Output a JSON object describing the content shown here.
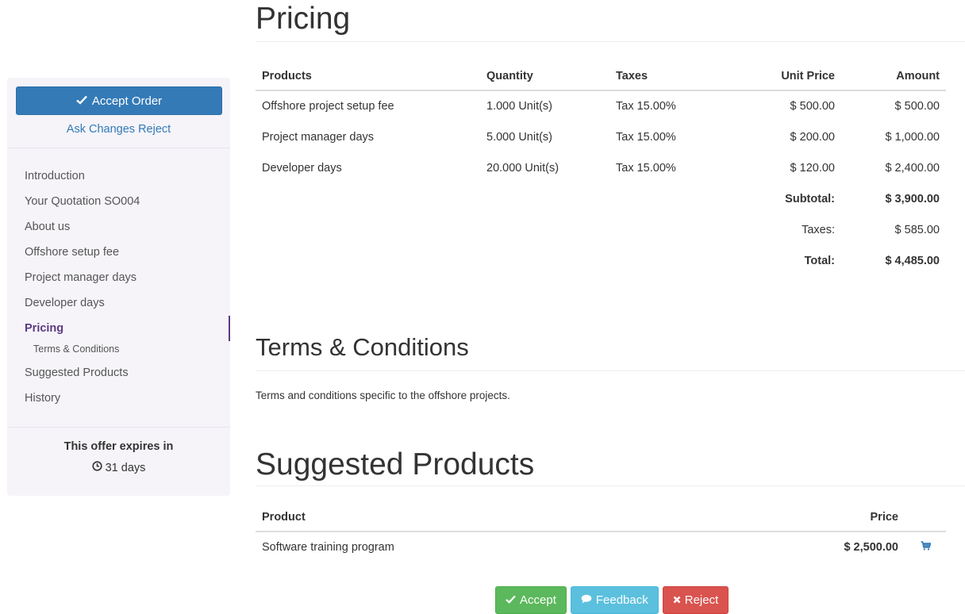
{
  "sidebar": {
    "accept_order_label": "Accept Order",
    "ask_changes_label": "Ask Changes",
    "reject_label": "Reject",
    "nav": [
      {
        "label": "Introduction"
      },
      {
        "label": "Your Quotation SO004"
      },
      {
        "label": "About us"
      },
      {
        "label": "Offshore setup fee"
      },
      {
        "label": "Project manager days"
      },
      {
        "label": "Developer days"
      },
      {
        "label": "Pricing"
      },
      {
        "label": "Terms & Conditions"
      },
      {
        "label": "Suggested Products"
      },
      {
        "label": "History"
      }
    ],
    "active_item": "Pricing",
    "expires_label": "This offer expires in",
    "expires_value": "31 days"
  },
  "pricing": {
    "title": "Pricing",
    "headers": {
      "product": "Products",
      "quantity": "Quantity",
      "taxes": "Taxes",
      "unit_price": "Unit Price",
      "amount": "Amount"
    },
    "rows": [
      {
        "product": "Offshore project setup fee",
        "quantity": "1.000 Unit(s)",
        "taxes": "Tax 15.00%",
        "unit_price": "$ 500.00",
        "amount": "$ 500.00"
      },
      {
        "product": "Project manager days",
        "quantity": "5.000 Unit(s)",
        "taxes": "Tax 15.00%",
        "unit_price": "$ 200.00",
        "amount": "$ 1,000.00"
      },
      {
        "product": "Developer days",
        "quantity": "20.000 Unit(s)",
        "taxes": "Tax 15.00%",
        "unit_price": "$ 120.00",
        "amount": "$ 2,400.00"
      }
    ],
    "subtotal_label": "Subtotal:",
    "subtotal_value": "$ 3,900.00",
    "taxes_label": "Taxes:",
    "taxes_value": "$ 585.00",
    "total_label": "Total:",
    "total_value": "$ 4,485.00"
  },
  "terms": {
    "title": "Terms & Conditions",
    "text": "Terms and conditions specific to the offshore projects."
  },
  "suggested": {
    "title": "Suggested Products",
    "headers": {
      "product": "Product",
      "price": "Price"
    },
    "rows": [
      {
        "product": "Software training program",
        "price": "$ 2,500.00"
      }
    ]
  },
  "actions": {
    "accept_label": "Accept",
    "feedback_label": "Feedback",
    "reject_label": "Reject"
  },
  "colors": {
    "primary": "#337ab7",
    "active_nav": "#5b3a84",
    "success": "#5cb85c",
    "info": "#5bc0de",
    "danger": "#d9534f",
    "sidebar_bg": "#f6f4f9"
  },
  "icons": {
    "accept_order": "check-icon",
    "expires": "clock-icon",
    "add_to_cart": "cart-icon",
    "accept": "check-icon",
    "feedback": "comment-icon",
    "reject": "times-icon"
  }
}
